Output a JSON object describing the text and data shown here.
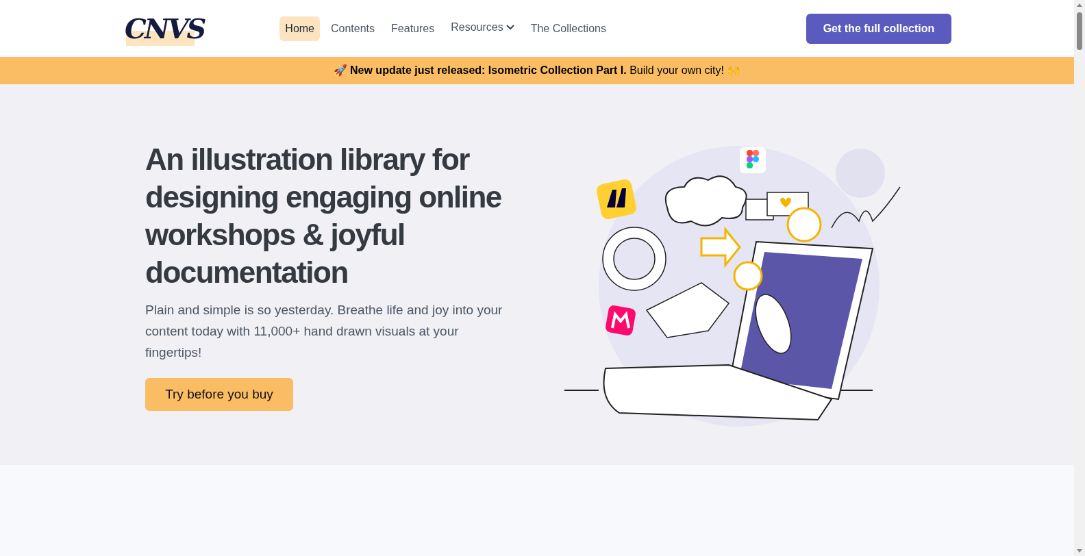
{
  "logo": {
    "text": "CNVS"
  },
  "nav": [
    {
      "label": "Home",
      "selected": true,
      "kind": "link"
    },
    {
      "label": "Contents",
      "selected": false,
      "kind": "link"
    },
    {
      "label": "Features",
      "selected": false,
      "kind": "link"
    },
    {
      "label": "Resources",
      "selected": false,
      "kind": "dropdown"
    },
    {
      "label": "The Collections",
      "selected": false,
      "kind": "link"
    }
  ],
  "cta": {
    "label": "Get the full collection"
  },
  "banner": {
    "text": "🚀 **New update just released: Isometric Collection Part I.** Build your own city! 🙌"
  },
  "hero": {
    "title": "An illustration library for designing engaging online workshops & joyful documentation",
    "subtitle": "Plain and simple is so yesterday. Breathe life and joy into your content today with 11,000+ hand drawn visuals at your fingertips!",
    "button": "Try before you buy"
  }
}
